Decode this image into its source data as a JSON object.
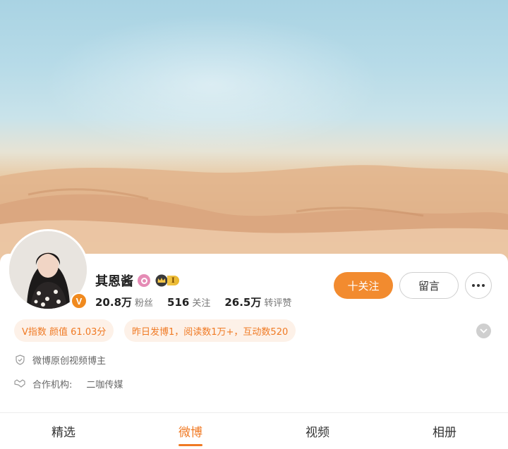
{
  "profile": {
    "name": "其恩酱",
    "verified_badge": "V",
    "level_badge": "I",
    "stats": [
      {
        "num": "20.8万",
        "label": "粉丝"
      },
      {
        "num": "516",
        "label": "关注"
      },
      {
        "num": "26.5万",
        "label": "转评赞"
      }
    ]
  },
  "actions": {
    "follow": "十关注",
    "message": "留言",
    "more": "more-dots-icon"
  },
  "tags": {
    "v_index": "V指数 颜值 61.03分",
    "activity": "昨日发博1，阅读数1万+，互动数520"
  },
  "info": {
    "creator": "微博原创视频博主",
    "agency_label": "合作机构:",
    "agency_value": "二咖传媒"
  },
  "tabs": [
    {
      "label": "精选",
      "active": false
    },
    {
      "label": "微博",
      "active": true
    },
    {
      "label": "视频",
      "active": false
    },
    {
      "label": "相册",
      "active": false
    }
  ],
  "colors": {
    "accent": "#f07a24",
    "follow_bg": "#f28b2f",
    "tag_bg": "#fdf1e8"
  }
}
